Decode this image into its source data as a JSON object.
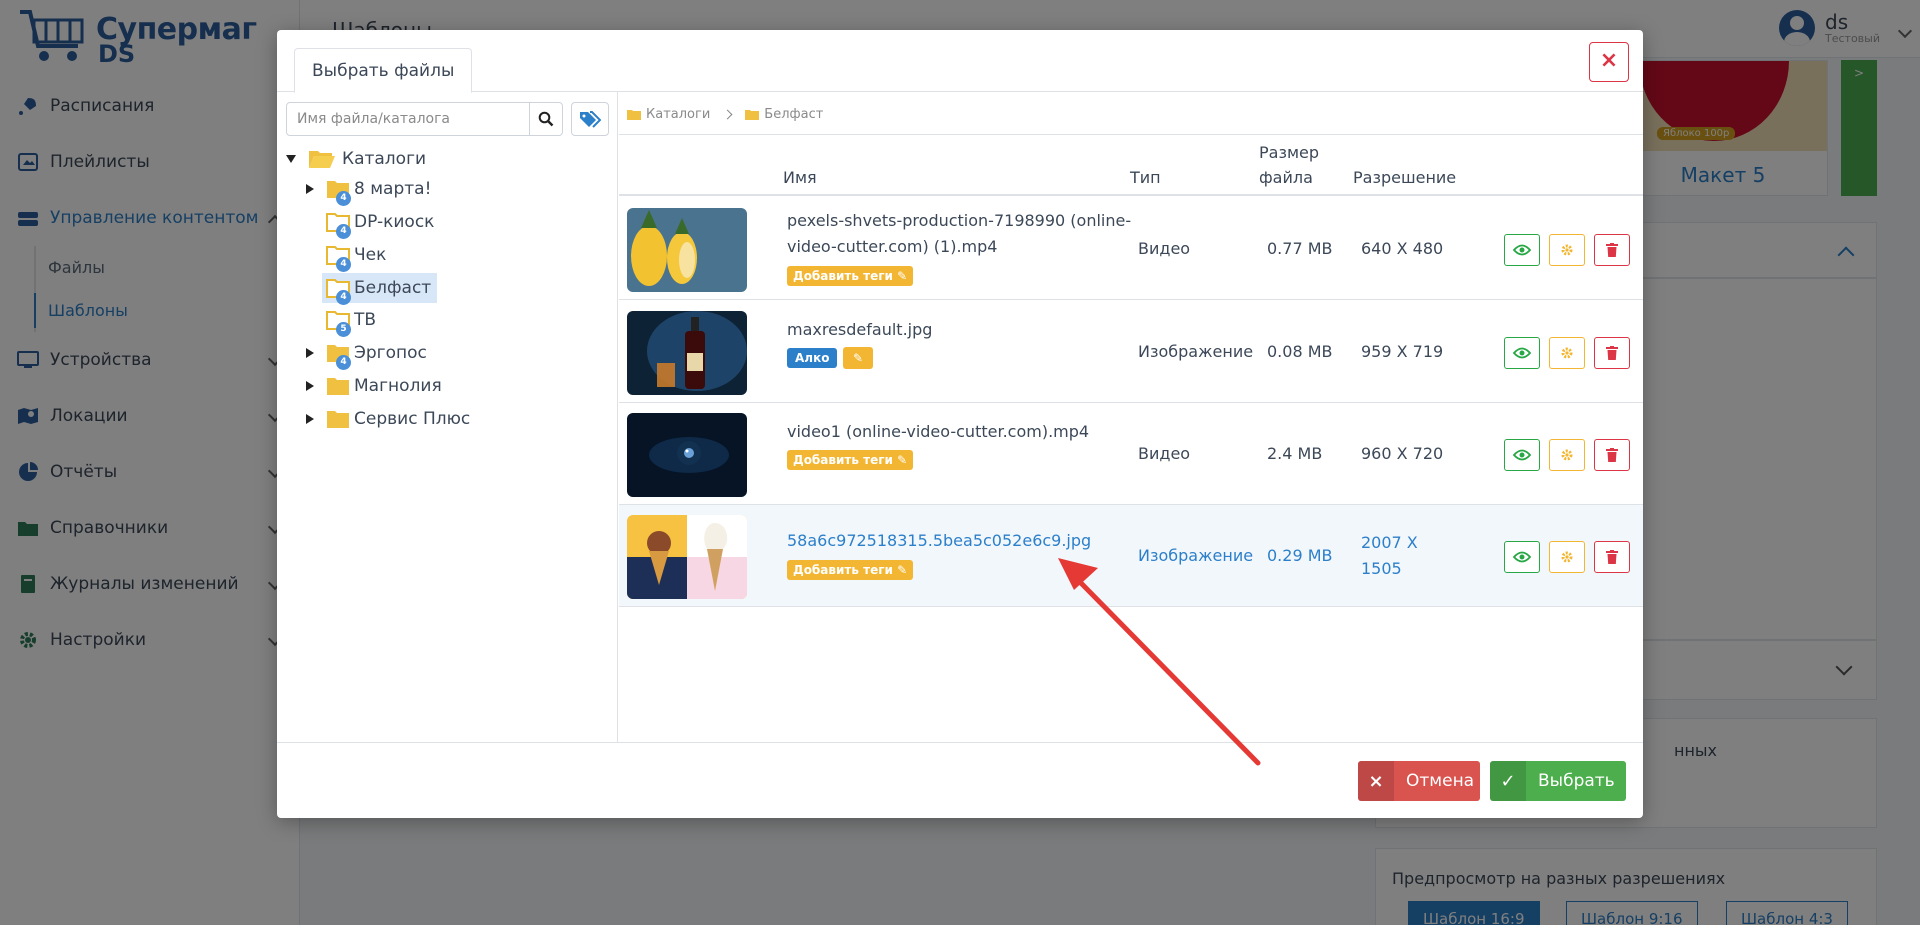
{
  "app": {
    "logo_line1": "Супермаг",
    "logo_line2": "DS",
    "page_title": "Шаблоны",
    "user_name": "ds",
    "user_role": "Тестовый"
  },
  "sidebar": {
    "items": [
      {
        "label": "Расписания",
        "icon": "rocket-icon"
      },
      {
        "label": "Плейлисты",
        "icon": "playlist-icon"
      },
      {
        "label": "Управление контентом",
        "icon": "database-icon"
      },
      {
        "label": "Устройства",
        "icon": "monitor-icon"
      },
      {
        "label": "Локации",
        "icon": "map-icon"
      },
      {
        "label": "Отчёты",
        "icon": "pie-chart-icon"
      },
      {
        "label": "Справочники",
        "icon": "folder-icon"
      },
      {
        "label": "Журналы изменений",
        "icon": "book-icon"
      },
      {
        "label": "Настройки",
        "icon": "gear-icon"
      }
    ],
    "sub_items": [
      "Файлы",
      "Шаблоны"
    ]
  },
  "background": {
    "card_label": "Макет 5",
    "card_price": "Яблоко 100р",
    "green_tab": ">",
    "panel_text": "нных",
    "preview_title": "Предпросмотр на разных разрешениях",
    "res_buttons": [
      "Шаблон 16:9",
      "Шаблон 9:16",
      "Шаблон 4:3"
    ]
  },
  "modal": {
    "tab_label": "Выбрать файлы",
    "close_label": "×",
    "search_placeholder": "Имя файла/каталога",
    "tree": {
      "root": "Каталоги",
      "nodes": [
        {
          "label": "8 марта!",
          "badge": "4",
          "expandable": true
        },
        {
          "label": "DP-киоск",
          "badge": "4",
          "expandable": false
        },
        {
          "label": "Чек",
          "badge": "4",
          "expandable": false
        },
        {
          "label": "Белфаст",
          "badge": "4",
          "expandable": false,
          "selected": true
        },
        {
          "label": "ТВ",
          "badge": "5",
          "expandable": false
        },
        {
          "label": "Эргопос",
          "badge": "4",
          "expandable": true
        },
        {
          "label": "Магнолия",
          "badge": "",
          "expandable": true
        },
        {
          "label": "Сервис Плюс",
          "badge": "",
          "expandable": true
        }
      ]
    },
    "breadcrumb": [
      "Каталоги",
      "Белфаст"
    ],
    "columns": {
      "name": "Имя",
      "type": "Тип",
      "size_line1": "Размер",
      "size_line2": "файла",
      "resolution": "Разрешение"
    },
    "files": [
      {
        "name_line1": "pexels-shvets-production-7198990 (online-",
        "name_line2": "video-cutter.com) (1).mp4",
        "type": "Видео",
        "size": "0.77 MB",
        "res_line1": "640 X 480",
        "res_line2": "",
        "tag": "Добавить теги ✎"
      },
      {
        "name_line1": "maxresdefault.jpg",
        "name_line2": "",
        "type": "Изображение",
        "size": "0.08 MB",
        "res_line1": "959 X 719",
        "res_line2": "",
        "tag": "Алко",
        "tag_edit": "✎"
      },
      {
        "name_line1": "video1 (online-video-cutter.com).mp4",
        "name_line2": "",
        "type": "Видео",
        "size": "2.4 MB",
        "res_line1": "960 X 720",
        "res_line2": "",
        "tag": "Добавить теги ✎"
      },
      {
        "name_line1": "58a6c972518315.5bea5c052e6c9.jpg",
        "name_line2": "",
        "type": "Изображение",
        "size": "0.29 MB",
        "res_line1": "2007 X",
        "res_line2": "1505",
        "tag": "Добавить теги ✎"
      }
    ],
    "cancel_label": "Отмена",
    "cancel_icon": "×",
    "select_label": "Выбрать",
    "select_icon": "✓"
  },
  "colors": {
    "primary": "#2c7fc9",
    "success": "#4cae4c",
    "danger": "#d9534f",
    "warning": "#f2b632",
    "annotation": "#e53935"
  }
}
